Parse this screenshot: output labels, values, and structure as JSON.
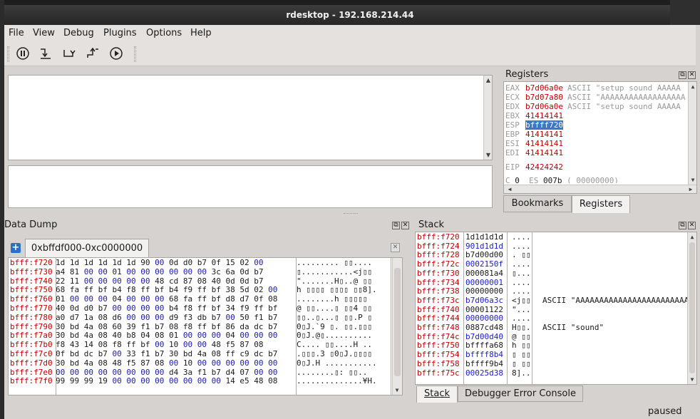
{
  "window": {
    "title": "rdesktop - 192.168.214.44"
  },
  "menu": [
    "File",
    "View",
    "Debug",
    "Plugins",
    "Options",
    "Help"
  ],
  "toolbar": [
    {
      "name": "pause-icon",
      "glyph": "⏸"
    },
    {
      "name": "step-into-icon",
      "glyph": "↴"
    },
    {
      "name": "step-over-icon",
      "glyph": "↷"
    },
    {
      "name": "step-out-icon",
      "glyph": "↗"
    },
    {
      "name": "run-icon",
      "glyph": "▶"
    }
  ],
  "registers": {
    "title": "Registers",
    "rows": [
      {
        "name": "EAX",
        "value": "b7d06a0e",
        "comment": "ASCII \"setup sound AAAAA"
      },
      {
        "name": "ECX",
        "value": "b7d07a80",
        "comment": "ASCII \"AAAAAAAAAAAAAAAAAA"
      },
      {
        "name": "EDX",
        "value": "b7d06a0e",
        "comment": "ASCII \"setup sound AAAAA"
      },
      {
        "name": "EBX",
        "value": "41414141",
        "comment": ""
      },
      {
        "name": "ESP",
        "value": "bffff720",
        "comment": "",
        "selected": true
      },
      {
        "name": "EBP",
        "value": "41414141",
        "comment": ""
      },
      {
        "name": "ESI",
        "value": "41414141",
        "comment": ""
      },
      {
        "name": "EDI",
        "value": "41414141",
        "comment": ""
      },
      {
        "name": "EIP",
        "value": "42424242",
        "comment": ""
      }
    ],
    "flags_line": {
      "c_label": "C",
      "c_value": "0",
      "es_label": "ES",
      "es_value": "007b",
      "es_extra": "( 00000000)"
    }
  },
  "right_tabs": [
    "Bookmarks",
    "Registers"
  ],
  "dump": {
    "title": "Data Dump",
    "tab_label": "0xbffdf000-0xc0000000",
    "rows": [
      {
        "addr": "bfff:f720",
        "hex": "1d 1d 1d 1d 1d 1d 90 00 0d d0 b7 0f 15 02 00",
        "ascii": "......... ▯▯...."
      },
      {
        "addr": "bfff:f730",
        "hex": "a4 81 00 00 01 00 00 00 00 00 00 3c 6a 0d b7",
        "ascii": "▯...........<j▯▯"
      },
      {
        "addr": "bfff:f740",
        "hex": "22 11 00 00 00 00 00 48 cd 87 08 40 0d 0d b7",
        "ascii": "\".......H▯..@ ▯▯"
      },
      {
        "addr": "bfff:f750",
        "hex": "68 fa ff bf b4 f8 ff bf b4 f9 ff bf 38 5d 02 00",
        "ascii": "h ▯▯▯▯ ▯▯▯▯ ▯▯8]."
      },
      {
        "addr": "bfff:f760",
        "hex": "01 00 00 00 04 00 00 00 68 fa ff bf d8 d7 0f 08",
        "ascii": "........h ▯▯▯▯▯"
      },
      {
        "addr": "bfff:f770",
        "hex": "40 0d d0 b7 00 00 00 00 b4 f8 ff bf 34 f9 ff bf",
        "ascii": "@ ▯▯....▯ ▯▯4 ▯▯"
      },
      {
        "addr": "bfff:f780",
        "hex": "a0 d7 1a 08 d6 00 00 00 d9 f3 db b7 00 50 f1 b7",
        "ascii": "▯▯..▯...▯ ▯▯.P ▯"
      },
      {
        "addr": "bfff:f790",
        "hex": "30 bd 4a 08 60 39 f1 b7 08 f8 ff bf 86 da dc b7",
        "ascii": "0▯J.`9 ▯. ▯▯.▯▯▯"
      },
      {
        "addr": "bfff:f7a0",
        "hex": "30 bd 4a 08 40 b8 04 08 01 00 00 00 04 00 00 00",
        "ascii": "0▯J.@▯.........."
      },
      {
        "addr": "bfff:f7b0",
        "hex": "f8 43 14 08 f8 ff bf 00 10 00 00 48 f5 87 08",
        "ascii": " C.... ▯▯....H .."
      },
      {
        "addr": "bfff:f7c0",
        "hex": "0f bd dc b7 00 33 f1 b7 30 bd 4a 08 ff c9 dc b7",
        "ascii": ".▯▯▯.3 ▯0▯J.▯▯▯▯"
      },
      {
        "addr": "bfff:f7d0",
        "hex": "30 bd 4a 08 48 f5 87 08 00 10 00 00 00 00 00 00",
        "ascii": "0▯J.H ..........."
      },
      {
        "addr": "bfff:f7e0",
        "hex": "00 00 00 00 00 00 00 00 d4 3a f1 b7 d4 07 00 00",
        "ascii": "........▯: ▯▯.."
      },
      {
        "addr": "bfff:f7f0",
        "hex": "99 99 99 19 00 00 00 00 00 00 00 00 14 e5 48 08",
        "ascii": "..............¥H."
      }
    ]
  },
  "stack": {
    "title": "Stack",
    "rows": [
      {
        "addr": "bfff:f720",
        "value": "1d1d1d1d",
        "ascii": "....",
        "comment": "",
        "ptr": false
      },
      {
        "addr": "bfff:f724",
        "value": "901d1d1d",
        "ascii": "....",
        "comment": "",
        "ptr": true
      },
      {
        "addr": "bfff:f728",
        "value": "b7d00d00",
        "ascii": ". ▯▯",
        "comment": "",
        "ptr": false
      },
      {
        "addr": "bfff:f72c",
        "value": "0002150f",
        "ascii": "....",
        "comment": "",
        "ptr": true
      },
      {
        "addr": "bfff:f730",
        "value": "000081a4",
        "ascii": "▯...",
        "comment": "",
        "ptr": false
      },
      {
        "addr": "bfff:f734",
        "value": "00000001",
        "ascii": "....",
        "comment": "",
        "ptr": true
      },
      {
        "addr": "bfff:f738",
        "value": "00000000",
        "ascii": "....",
        "comment": "",
        "ptr": false
      },
      {
        "addr": "bfff:f73c",
        "value": "b7d06a3c",
        "ascii": "<j▯▯",
        "comment": "ASCII \"AAAAAAAAAAAAAAAAAAAAAAAAA",
        "ptr": true
      },
      {
        "addr": "bfff:f740",
        "value": "00001122",
        "ascii": "\"...",
        "comment": "",
        "ptr": false
      },
      {
        "addr": "bfff:f744",
        "value": "00000000",
        "ascii": "....",
        "comment": "",
        "ptr": true
      },
      {
        "addr": "bfff:f748",
        "value": "0887cd48",
        "ascii": "H▯▯.",
        "comment": "ASCII \"sound\"",
        "ptr": false
      },
      {
        "addr": "bfff:f74c",
        "value": "b7d00d40",
        "ascii": "@ ▯▯",
        "comment": "",
        "ptr": true
      },
      {
        "addr": "bfff:f750",
        "value": "bffffa68",
        "ascii": "h ▯▯",
        "comment": "",
        "ptr": false
      },
      {
        "addr": "bfff:f754",
        "value": "bffff8b4",
        "ascii": "▯ ▯▯",
        "comment": "",
        "ptr": true
      },
      {
        "addr": "bfff:f758",
        "value": "bffff9b4",
        "ascii": "▯ ▯▯",
        "comment": "",
        "ptr": false
      },
      {
        "addr": "bfff:f75c",
        "value": "00025d38",
        "ascii": "8]..",
        "comment": "",
        "ptr": true
      }
    ]
  },
  "bottom_tabs": [
    "Stack",
    "Debugger Error Console"
  ],
  "status": "paused"
}
